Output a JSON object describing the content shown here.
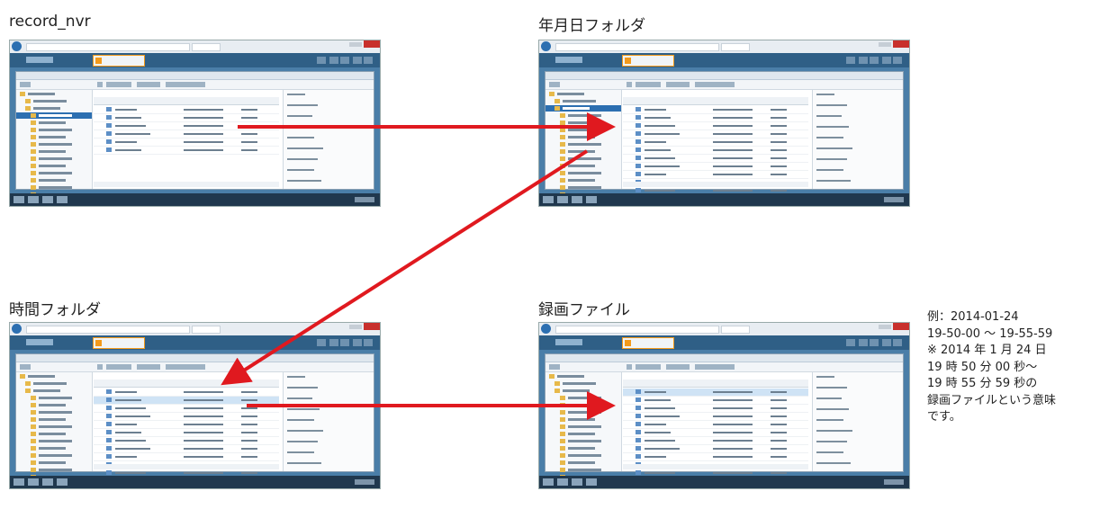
{
  "panels": [
    {
      "caption": "record_nvr"
    },
    {
      "caption": "年月日フォルダ"
    },
    {
      "caption": "時間フォルダ"
    },
    {
      "caption": "録画ファイル"
    }
  ],
  "note": {
    "line1": "例：2014-01-24",
    "line2": "19-50-00 ～ 19-55-59",
    "line3": "※ 2014 年 1 月 24 日",
    "line4": "19 時 50 分 00 秒～",
    "line5": "19 時 55 分 59 秒の",
    "line6": "録画ファイルという意味",
    "line7": "です。"
  },
  "colors": {
    "arrow": "#e0191f",
    "desktop": "#4a7ea8",
    "selection": "#2c6fb1"
  },
  "icons": [
    "folder-icon",
    "file-icon",
    "arrow-right",
    "arrow-diagonal"
  ]
}
